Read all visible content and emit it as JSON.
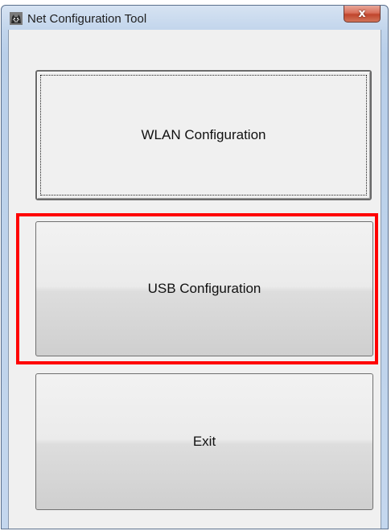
{
  "window": {
    "title": "Net Configuration Tool",
    "app_icon": "cat-app-icon",
    "close_icon": "close-icon",
    "close_glyph": "x"
  },
  "buttons": {
    "wlan_label": "WLAN Configuration",
    "usb_label": "USB Configuration",
    "exit_label": "Exit"
  },
  "highlight": {
    "target": "usb-configuration-button",
    "color": "#ff0000"
  }
}
